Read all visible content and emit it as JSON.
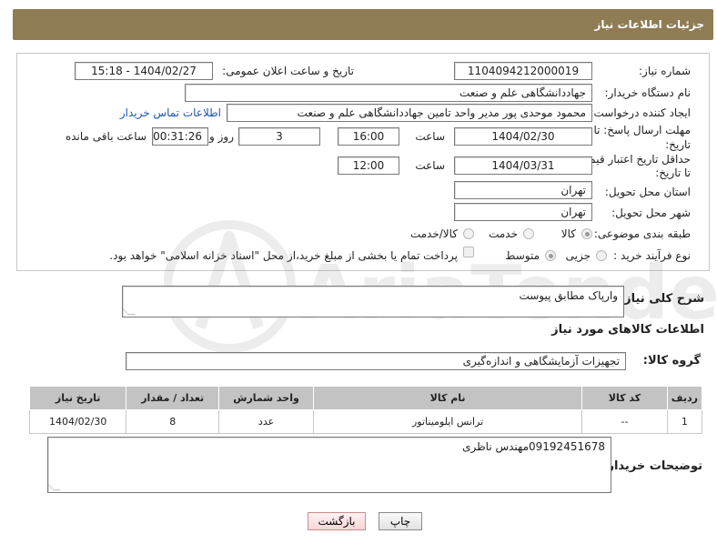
{
  "header": {
    "title": "جزئیات اطلاعات نیاز"
  },
  "form": {
    "need_number_label": "شماره نیاز:",
    "need_number": "1104094212000019",
    "announce_label": "تاریخ و ساعت اعلان عمومی:",
    "announce_value": "1404/02/27 - 15:18",
    "buyer_org_label": "نام دستگاه خریدار:",
    "buyer_org": "جهاددانشگاهی علم و صنعت",
    "creator_label": "ایجاد کننده درخواست:",
    "creator": "محمود موحدی پور مدیر واحد تامین جهاددانشگاهی علم و صنعت",
    "contact_link": "اطلاعات تماس خریدار",
    "deadline_label_1": "مهلت ارسال پاسخ: تا",
    "deadline_label_2": "تاریخ:",
    "deadline_date": "1404/02/30",
    "time_word": "ساعت",
    "deadline_time": "16:00",
    "days_value": "3",
    "days_and_label": "روز و",
    "remaining_time": "00:31:26",
    "remaining_label": "ساعت باقی مانده",
    "validity_label_1": "حداقل تاریخ اعتبار قیمت:",
    "validity_label_2": "تا تاریخ:",
    "validity_date": "1404/03/31",
    "validity_time": "12:00",
    "province_label": "استان محل تحویل:",
    "province": "تهران",
    "city_label": "شهر محل تحویل:",
    "city": "تهران",
    "category_label": "طبقه بندی موضوعی:",
    "category_options": [
      "کالا",
      "خدمت",
      "کالا/خدمت"
    ],
    "category_selected": "کالا",
    "process_label": "نوع فرآیند خرید :",
    "process_options": [
      "جزیی",
      "متوسط"
    ],
    "payment_note": "پرداخت تمام یا بخشی از مبلغ خرید،از محل \"اسناد خزانه اسلامی\" خواهد بود."
  },
  "description": {
    "label": "شرح کلی نیاز:",
    "value": "وارپاک مطابق پیوست"
  },
  "goods": {
    "section_title": "اطلاعات کالاهای مورد نیاز",
    "group_label": "گروه کالا:",
    "group_value": "تجهیزات آزمایشگاهی و اندازه‌گیری",
    "table": {
      "headers": [
        "ردیف",
        "کد کالا",
        "نام کالا",
        "واحد شمارش",
        "تعداد / مقدار",
        "تاریخ نیاز"
      ],
      "rows": [
        [
          "1",
          "--",
          "ترانس ایلومیناتور",
          "عدد",
          "8",
          "1404/02/30"
        ]
      ]
    }
  },
  "buyer_notes": {
    "label": "توضیحات خریدار:",
    "value": "09192451678مهندس ناظری"
  },
  "buttons": {
    "print": "چاپ",
    "back": "بازگشت"
  },
  "watermark": {
    "text": "AriaTender.neT"
  }
}
